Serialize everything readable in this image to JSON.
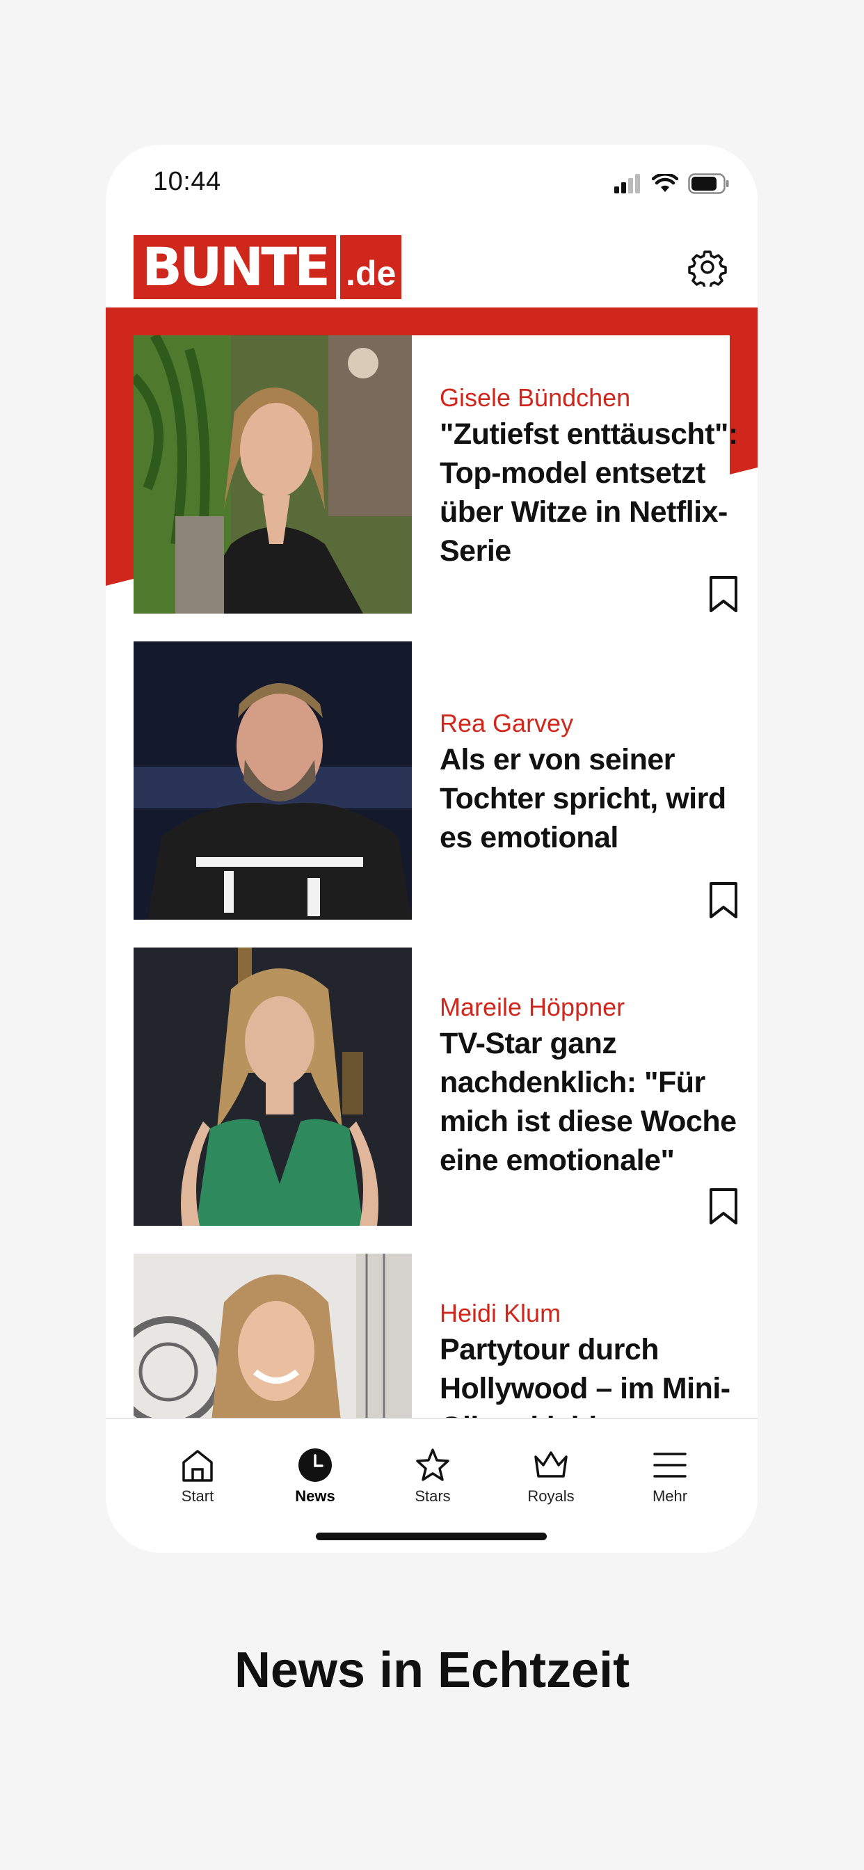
{
  "status_bar": {
    "time": "10:44"
  },
  "header": {
    "logo_main": "BUNTE",
    "logo_suffix": ".de"
  },
  "articles": [
    {
      "kicker": "Gisele Bündchen",
      "headline": "\"Zutiefst enttäuscht\": Top-model entsetzt über Witze in Netflix-Serie",
      "image": "portrait-woman-blonde"
    },
    {
      "kicker": "Rea Garvey",
      "headline": "Als er von seiner Tochter spricht, wird es emotional",
      "image": "portrait-man-beard"
    },
    {
      "kicker": "Mareile Höppner",
      "headline": "TV-Star ganz nachdenklich: \"Für mich ist diese Woche eine emotionale\"",
      "image": "portrait-woman-green-dress"
    },
    {
      "kicker": "Heidi Klum",
      "headline": "Partytour durch Hollywood – im Mini-Glitzerkleid",
      "image": "portrait-woman-smiling"
    }
  ],
  "tabbar": {
    "items": [
      {
        "label": "Start",
        "icon": "home-icon"
      },
      {
        "label": "News",
        "icon": "clock-icon",
        "active": true
      },
      {
        "label": "Stars",
        "icon": "star-icon"
      },
      {
        "label": "Royals",
        "icon": "crown-icon"
      },
      {
        "label": "Mehr",
        "icon": "menu-icon"
      }
    ]
  },
  "caption": "News in Echtzeit",
  "colors": {
    "brand_red": "#d0271d",
    "background": "#f5f5f5"
  }
}
